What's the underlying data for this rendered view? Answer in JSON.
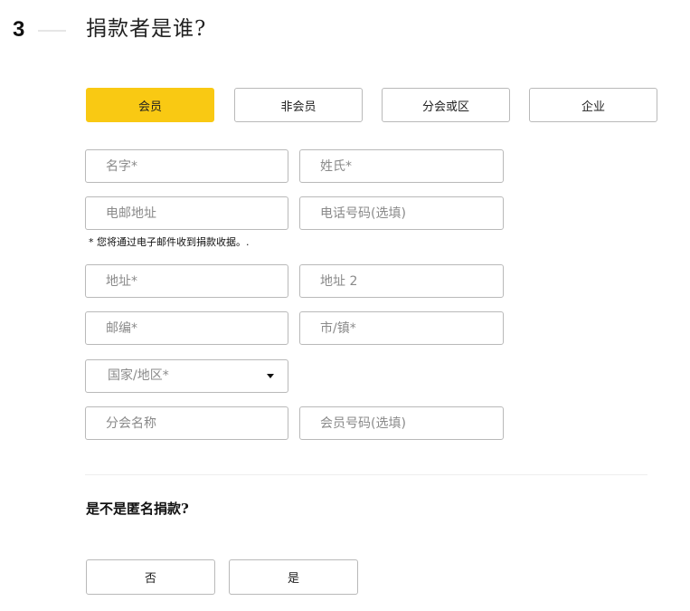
{
  "step": {
    "number": "3",
    "title": "捐款者是谁?"
  },
  "donor_types": [
    {
      "label": "会员",
      "selected": true
    },
    {
      "label": "非会员",
      "selected": false
    },
    {
      "label": "分会或区",
      "selected": false
    },
    {
      "label": "企业",
      "selected": false
    }
  ],
  "form": {
    "first_name": {
      "placeholder": "名字*",
      "value": ""
    },
    "last_name": {
      "placeholder": "姓氏*",
      "value": ""
    },
    "email": {
      "placeholder": "电邮地址",
      "value": ""
    },
    "phone": {
      "placeholder": "电话号码(选填)",
      "value": ""
    },
    "email_note": "* 您将通过电子邮件收到捐款收据。.",
    "address1": {
      "placeholder": "地址*",
      "value": ""
    },
    "address2": {
      "placeholder": "地址 2",
      "value": ""
    },
    "postal_code": {
      "placeholder": "邮编*",
      "value": ""
    },
    "city": {
      "placeholder": "市/镇*",
      "value": ""
    },
    "country": {
      "label": "国家/地区*"
    },
    "chapter_name": {
      "placeholder": "分会名称",
      "value": ""
    },
    "member_number": {
      "placeholder": "会员号码(选填)",
      "value": ""
    }
  },
  "anonymous": {
    "question": "是不是匿名捐款?",
    "no_label": "否",
    "yes_label": "是"
  },
  "colors": {
    "accent": "#f9c913",
    "border": "#b9b9b9",
    "placeholder": "#8a8a8a"
  }
}
